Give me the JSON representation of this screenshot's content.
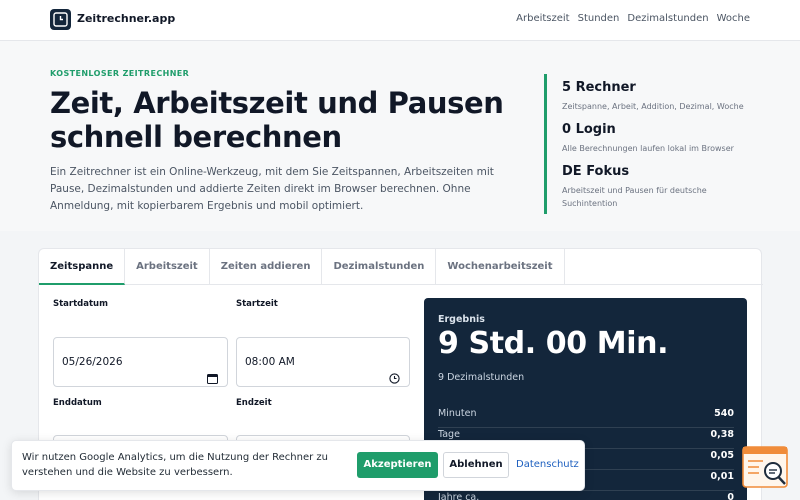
{
  "header": {
    "brand": "Zeitrechner.app",
    "nav": [
      "Arbeitszeit",
      "Stunden",
      "Dezimalstunden",
      "Woche"
    ]
  },
  "hero": {
    "eyebrow": "KOSTENLOSER ZEITRECHNER",
    "title": "Zeit, Arbeitszeit und Pausen schnell berechnen",
    "intro": "Ein Zeitrechner ist ein Online-Werkzeug, mit dem Sie Zeitspannen, Arbeitszeiten mit Pause, Dezimalstunden und addierte Zeiten direkt im Browser berechnen. Ohne Anmeldung, mit kopierbarem Ergebnis und mobil optimiert.",
    "stats": [
      {
        "value": "5 Rechner",
        "desc": "Zeitspanne, Arbeit, Addition, Dezimal, Woche"
      },
      {
        "value": "0 Login",
        "desc": "Alle Berechnungen laufen lokal im Browser"
      },
      {
        "value": "DE Fokus",
        "desc": "Arbeitszeit und Pausen für deutsche Suchintention"
      }
    ]
  },
  "calculator": {
    "tabs": [
      "Zeitspanne",
      "Arbeitszeit",
      "Zeiten addieren",
      "Dezimalstunden",
      "Wochenarbeitszeit"
    ],
    "start_date_label": "Startdatum",
    "start_date_value": "05/26/2026",
    "start_time_label": "Startzeit",
    "start_time_value": "08:00 AM",
    "end_date_label": "Enddatum",
    "end_time_label": "Endzeit"
  },
  "result": {
    "label": "Ergebnis",
    "main": "9 Std. 00 Min.",
    "sub": "9 Dezimalstunden",
    "rows": [
      {
        "label": "Minuten",
        "value": "540"
      },
      {
        "label": "Tage",
        "value": "0,38"
      },
      {
        "label": "",
        "value": "0,05"
      },
      {
        "label": "",
        "value": "0,01"
      },
      {
        "label": "Jahre ca.",
        "value": "0"
      }
    ]
  },
  "cookie": {
    "text": "Wir nutzen Google Analytics, um die Nutzung der Rechner zu verstehen und die Website zu verbessern.",
    "accept": "Akzeptieren",
    "decline": "Ablehnen",
    "privacy": "Datenschutz"
  },
  "colors": {
    "accent": "#1f9d6b",
    "dark": "#13263b",
    "link": "#1d5fbf"
  },
  "icons": {
    "logo": "clock-icon",
    "date": "calendar-icon",
    "time": "clock-icon",
    "badge": "search-document-icon"
  }
}
